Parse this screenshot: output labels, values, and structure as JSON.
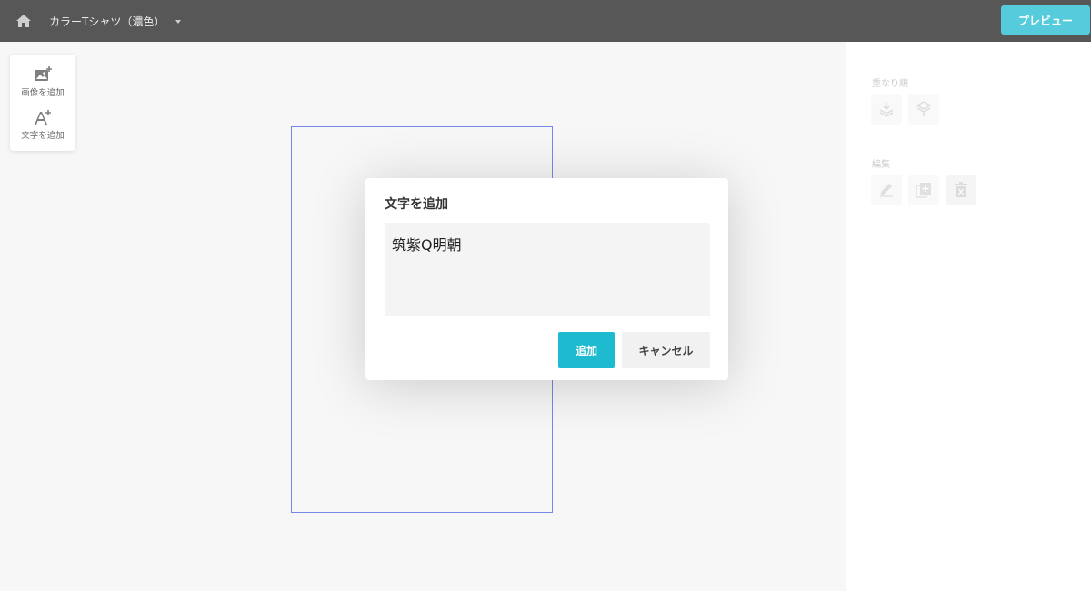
{
  "header": {
    "product_name": "カラーTシャツ（濃色）",
    "preview_label": "プレビュー"
  },
  "toolbox": {
    "add_image_label": "画像を追加",
    "add_text_label": "文字を追加"
  },
  "right_panel": {
    "order_label": "重なり順",
    "edit_label": "編集"
  },
  "dialog": {
    "title": "文字を追加",
    "input_value": "筑紫Q明朝",
    "add_label": "追加",
    "cancel_label": "キャンセル"
  },
  "colors": {
    "accent": "#1ebad0",
    "topbar": "#1f1f1f",
    "print_area_border": "#4a61e4"
  },
  "icons": {
    "home": "home-icon",
    "add_image": "image-plus-icon",
    "add_text": "text-plus-icon",
    "bring_front": "layer-down-icon",
    "send_back": "layer-up-icon",
    "edit": "pencil-icon",
    "duplicate": "duplicate-icon",
    "delete": "trash-icon"
  }
}
